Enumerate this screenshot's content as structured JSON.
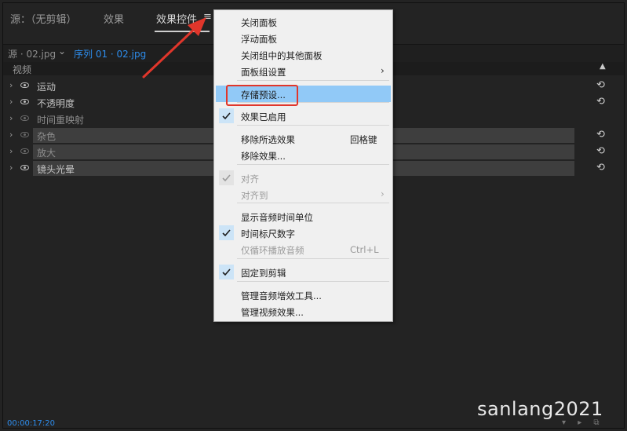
{
  "tabs": [
    "源：（无剪辑）",
    "效果",
    "效果控件",
    "≡"
  ],
  "subheader": {
    "source_clip": "源 · 02.jpg",
    "sequence": "序列 01 · 02.jpg"
  },
  "column_header": "视频",
  "effects": [
    {
      "name": "运动",
      "dim": false,
      "has_reset": true,
      "applied": false
    },
    {
      "name": "不透明度",
      "dim": false,
      "has_reset": true,
      "applied": false
    },
    {
      "name": "时间重映射",
      "dim": true,
      "has_reset": false,
      "applied": false
    },
    {
      "name": "杂色",
      "dim": true,
      "has_reset": true,
      "applied": true
    },
    {
      "name": "放大",
      "dim": true,
      "has_reset": true,
      "applied": true
    },
    {
      "name": "镜头光晕",
      "dim": false,
      "has_reset": true,
      "applied": true
    }
  ],
  "timecode": "00:00:17:20",
  "watermark": "sanlang2021",
  "menu": {
    "items": [
      {
        "label": "关闭面板"
      },
      {
        "label": "浮动面板"
      },
      {
        "label": "关闭组中的其他面板"
      },
      {
        "label": "面板组设置",
        "submenu": true
      },
      {
        "label": "存储预设...",
        "highlighted": true
      },
      {
        "label": "效果已启用",
        "checked": true
      },
      {
        "label": "移除所选效果",
        "shortcut": "回格键"
      },
      {
        "label": "移除效果..."
      },
      {
        "label": "对齐",
        "checked": true,
        "disabled": true
      },
      {
        "label": "对齐到",
        "submenu": true,
        "disabled": true
      },
      {
        "label": "显示音频时间单位"
      },
      {
        "label": "时间标尺数字",
        "checked": true
      },
      {
        "label": "仅循环播放音频",
        "shortcut": "Ctrl+L",
        "disabled": true
      },
      {
        "label": "固定到剪辑",
        "checked": true
      },
      {
        "label": "管理音频增效工具..."
      },
      {
        "label": "管理视频效果..."
      }
    ]
  },
  "colors": {
    "accent_blue": "#2d8ceb",
    "menu_highlight": "#91c9f7",
    "annotation_red": "#e0362b"
  }
}
